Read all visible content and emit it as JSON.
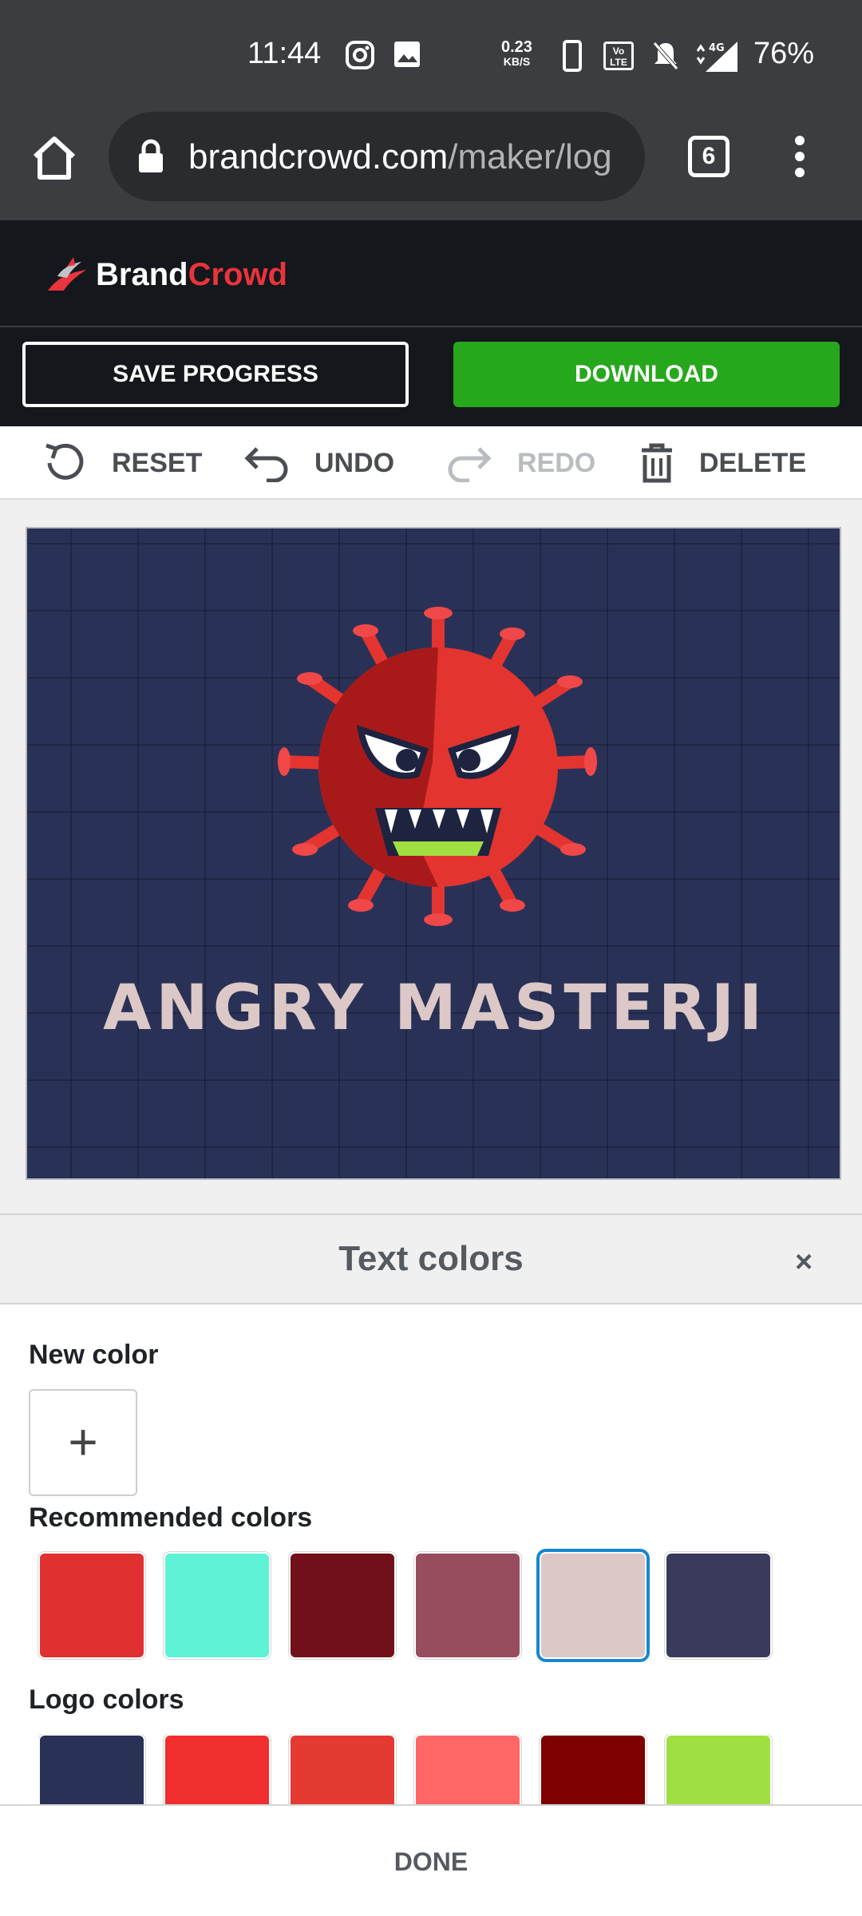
{
  "status_bar": {
    "time": "11:44",
    "net_speed_value": "0.23",
    "net_speed_unit": "KB/S",
    "volte_label": "Vo LTE",
    "network_label": "4G",
    "battery": "76%",
    "icons": [
      "instagram-icon",
      "gallery-icon",
      "phone-icon",
      "volte-icon",
      "mute-icon",
      "signal-icon"
    ]
  },
  "browser": {
    "url_host": "brandcrowd.com",
    "url_path": "/maker/log",
    "tab_count": "6"
  },
  "brand": {
    "name_part1": "Brand",
    "name_part2": "Crowd",
    "accent_color": "#e8343c"
  },
  "actions": {
    "save_label": "SAVE PROGRESS",
    "download_label": "DOWNLOAD",
    "download_color": "#27a81c"
  },
  "toolbar": {
    "reset_label": "RESET",
    "undo_label": "UNDO",
    "redo_label": "REDO",
    "delete_label": "DELETE"
  },
  "canvas": {
    "background_color": "#2a3157",
    "logo_text": "ANGRY MASTERJI",
    "logo_text_color": "#dcc8c6"
  },
  "sheet": {
    "title": "Text colors",
    "close_label": "×",
    "new_color_label": "New color",
    "new_color_button": "+",
    "recommended_label": "Recommended colors",
    "recommended_colors": [
      "#e03030",
      "#5ef3d6",
      "#71101a",
      "#974d5e",
      "#dcc8c6",
      "#3a3a5c"
    ],
    "recommended_selected_index": 4,
    "logo_colors_label": "Logo colors",
    "logo_colors": [
      "#2a3157",
      "#f02e2e",
      "#e43a32",
      "#ff6666",
      "#7e0000",
      "#a0df42"
    ],
    "done_label": "DONE"
  }
}
